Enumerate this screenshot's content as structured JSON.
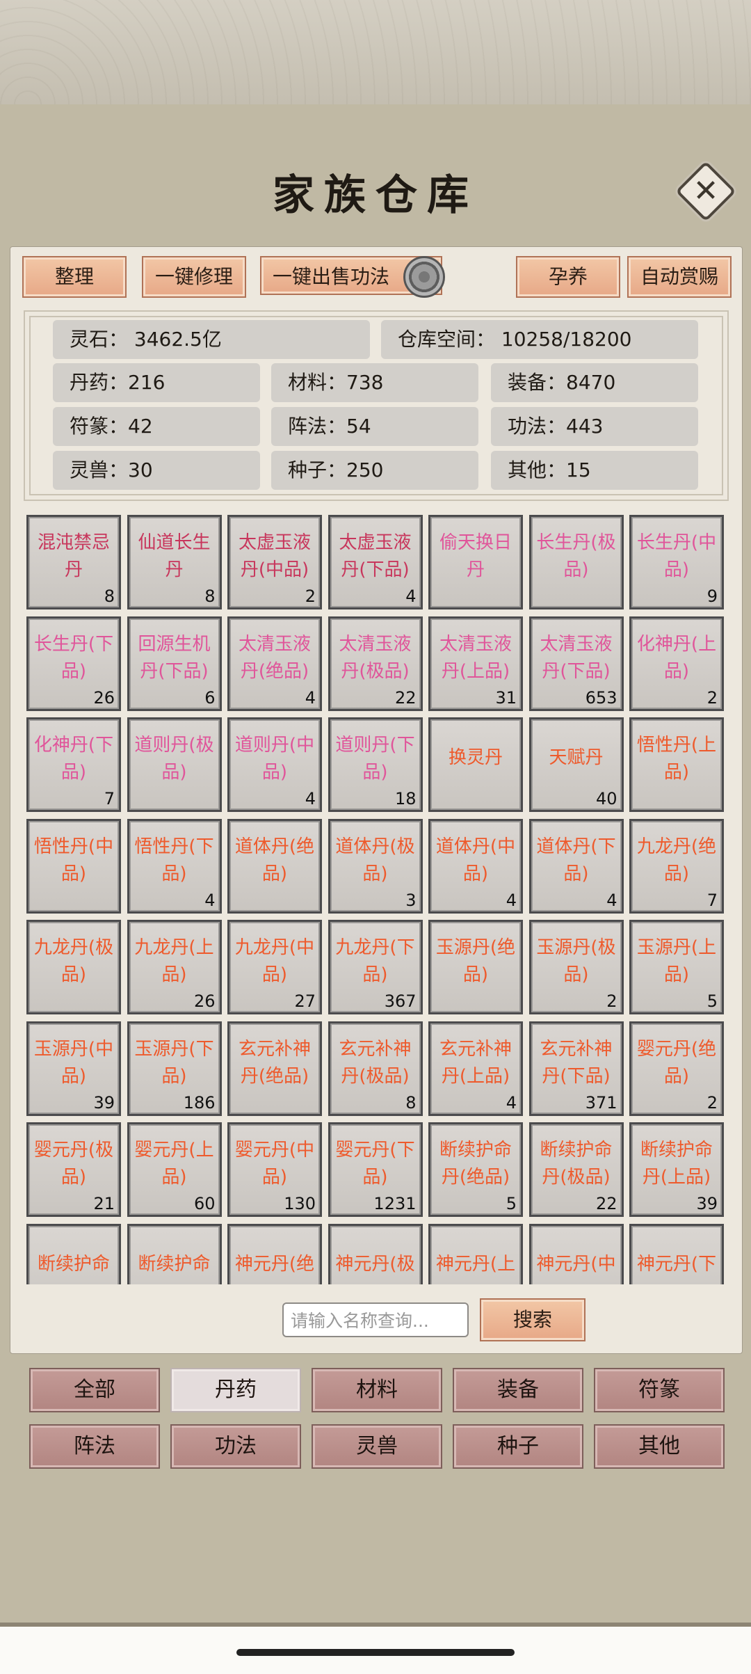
{
  "title": "家族仓库",
  "close_icon": "✕",
  "toolbar": {
    "sort": "整理",
    "repair_all": "一键修理",
    "sell_skills": "一键出售功法",
    "nurture": "孕养",
    "auto_reward": "自动赏赐"
  },
  "stats": {
    "spirit_stone": "灵石：  3462.5亿",
    "capacity": "仓库空间：   10258/18200",
    "pills": "丹药：216",
    "materials": "材料：738",
    "equipment": "装备：8470",
    "talismans": "符篆：42",
    "formations": "阵法：54",
    "skills": "功法：443",
    "beasts": "灵兽：30",
    "seeds": "种子：250",
    "other": "其他：15"
  },
  "colors": {
    "gold_tier": "#c8365c",
    "pink_tier": "#e0559a",
    "orange_tier": "#ee5a2c"
  },
  "items": [
    {
      "l1": "混沌禁忌",
      "l2": "丹",
      "count": "8",
      "tier": "gold"
    },
    {
      "l1": "仙道长生",
      "l2": "丹",
      "count": "8",
      "tier": "gold"
    },
    {
      "l1": "太虚玉液",
      "l2": "丹(中品)",
      "count": "2",
      "tier": "gold"
    },
    {
      "l1": "太虚玉液",
      "l2": "丹(下品)",
      "count": "4",
      "tier": "gold"
    },
    {
      "l1": "偷天换日",
      "l2": "丹",
      "count": "",
      "tier": "pink"
    },
    {
      "l1": "长生丹(极",
      "l2": "品)",
      "count": "",
      "tier": "pink"
    },
    {
      "l1": "长生丹(中",
      "l2": "品)",
      "count": "9",
      "tier": "pink"
    },
    {
      "l1": "长生丹(下",
      "l2": "品)",
      "count": "26",
      "tier": "pink"
    },
    {
      "l1": "回源生机",
      "l2": "丹(下品)",
      "count": "6",
      "tier": "pink"
    },
    {
      "l1": "太清玉液",
      "l2": "丹(绝品)",
      "count": "4",
      "tier": "pink"
    },
    {
      "l1": "太清玉液",
      "l2": "丹(极品)",
      "count": "22",
      "tier": "pink"
    },
    {
      "l1": "太清玉液",
      "l2": "丹(上品)",
      "count": "31",
      "tier": "pink"
    },
    {
      "l1": "太清玉液",
      "l2": "丹(下品)",
      "count": "653",
      "tier": "pink"
    },
    {
      "l1": "化神丹(上",
      "l2": "品)",
      "count": "2",
      "tier": "pink"
    },
    {
      "l1": "化神丹(下",
      "l2": "品)",
      "count": "7",
      "tier": "pink"
    },
    {
      "l1": "道则丹(极",
      "l2": "品)",
      "count": "",
      "tier": "pink"
    },
    {
      "l1": "道则丹(中",
      "l2": "品)",
      "count": "4",
      "tier": "pink"
    },
    {
      "l1": "道则丹(下",
      "l2": "品)",
      "count": "18",
      "tier": "pink"
    },
    {
      "l1": "换灵丹",
      "l2": "",
      "count": "",
      "tier": "orange"
    },
    {
      "l1": "天赋丹",
      "l2": "",
      "count": "40",
      "tier": "orange"
    },
    {
      "l1": "悟性丹(上",
      "l2": "品)",
      "count": "",
      "tier": "orange"
    },
    {
      "l1": "悟性丹(中",
      "l2": "品)",
      "count": "",
      "tier": "orange"
    },
    {
      "l1": "悟性丹(下",
      "l2": "品)",
      "count": "4",
      "tier": "orange"
    },
    {
      "l1": "道体丹(绝",
      "l2": "品)",
      "count": "",
      "tier": "orange"
    },
    {
      "l1": "道体丹(极",
      "l2": "品)",
      "count": "3",
      "tier": "orange"
    },
    {
      "l1": "道体丹(中",
      "l2": "品)",
      "count": "4",
      "tier": "orange"
    },
    {
      "l1": "道体丹(下",
      "l2": "品)",
      "count": "4",
      "tier": "orange"
    },
    {
      "l1": "九龙丹(绝",
      "l2": "品)",
      "count": "7",
      "tier": "orange"
    },
    {
      "l1": "九龙丹(极",
      "l2": "品)",
      "count": "",
      "tier": "orange"
    },
    {
      "l1": "九龙丹(上",
      "l2": "品)",
      "count": "26",
      "tier": "orange"
    },
    {
      "l1": "九龙丹(中",
      "l2": "品)",
      "count": "27",
      "tier": "orange"
    },
    {
      "l1": "九龙丹(下",
      "l2": "品)",
      "count": "367",
      "tier": "orange"
    },
    {
      "l1": "玉源丹(绝",
      "l2": "品)",
      "count": "",
      "tier": "orange"
    },
    {
      "l1": "玉源丹(极",
      "l2": "品)",
      "count": "2",
      "tier": "orange"
    },
    {
      "l1": "玉源丹(上",
      "l2": "品)",
      "count": "5",
      "tier": "orange"
    },
    {
      "l1": "玉源丹(中",
      "l2": "品)",
      "count": "39",
      "tier": "orange"
    },
    {
      "l1": "玉源丹(下",
      "l2": "品)",
      "count": "186",
      "tier": "orange"
    },
    {
      "l1": "玄元补神",
      "l2": "丹(绝品)",
      "count": "",
      "tier": "orange"
    },
    {
      "l1": "玄元补神",
      "l2": "丹(极品)",
      "count": "8",
      "tier": "orange"
    },
    {
      "l1": "玄元补神",
      "l2": "丹(上品)",
      "count": "4",
      "tier": "orange"
    },
    {
      "l1": "玄元补神",
      "l2": "丹(下品)",
      "count": "371",
      "tier": "orange"
    },
    {
      "l1": "婴元丹(绝",
      "l2": "品)",
      "count": "2",
      "tier": "orange"
    },
    {
      "l1": "婴元丹(极",
      "l2": "品)",
      "count": "21",
      "tier": "orange"
    },
    {
      "l1": "婴元丹(上",
      "l2": "品)",
      "count": "60",
      "tier": "orange"
    },
    {
      "l1": "婴元丹(中",
      "l2": "品)",
      "count": "130",
      "tier": "orange"
    },
    {
      "l1": "婴元丹(下",
      "l2": "品)",
      "count": "1231",
      "tier": "orange"
    },
    {
      "l1": "断续护命",
      "l2": "丹(绝品)",
      "count": "5",
      "tier": "orange"
    },
    {
      "l1": "断续护命",
      "l2": "丹(极品)",
      "count": "22",
      "tier": "orange"
    },
    {
      "l1": "断续护命",
      "l2": "丹(上品)",
      "count": "39",
      "tier": "orange"
    },
    {
      "l1": "断续护命",
      "l2": "",
      "count": "",
      "tier": "orange"
    },
    {
      "l1": "断续护命",
      "l2": "",
      "count": "",
      "tier": "orange"
    },
    {
      "l1": "神元丹(绝",
      "l2": "",
      "count": "",
      "tier": "orange"
    },
    {
      "l1": "神元丹(极",
      "l2": "",
      "count": "",
      "tier": "orange"
    },
    {
      "l1": "神元丹(上",
      "l2": "",
      "count": "",
      "tier": "orange"
    },
    {
      "l1": "神元丹(中",
      "l2": "",
      "count": "",
      "tier": "orange"
    },
    {
      "l1": "神元丹(下",
      "l2": "",
      "count": "",
      "tier": "orange"
    }
  ],
  "search": {
    "placeholder": "请输入名称查询...",
    "button": "搜索"
  },
  "categories": [
    "全部",
    "丹药",
    "材料",
    "装备",
    "符篆",
    "阵法",
    "功法",
    "灵兽",
    "种子",
    "其他"
  ],
  "active_category": "丹药"
}
